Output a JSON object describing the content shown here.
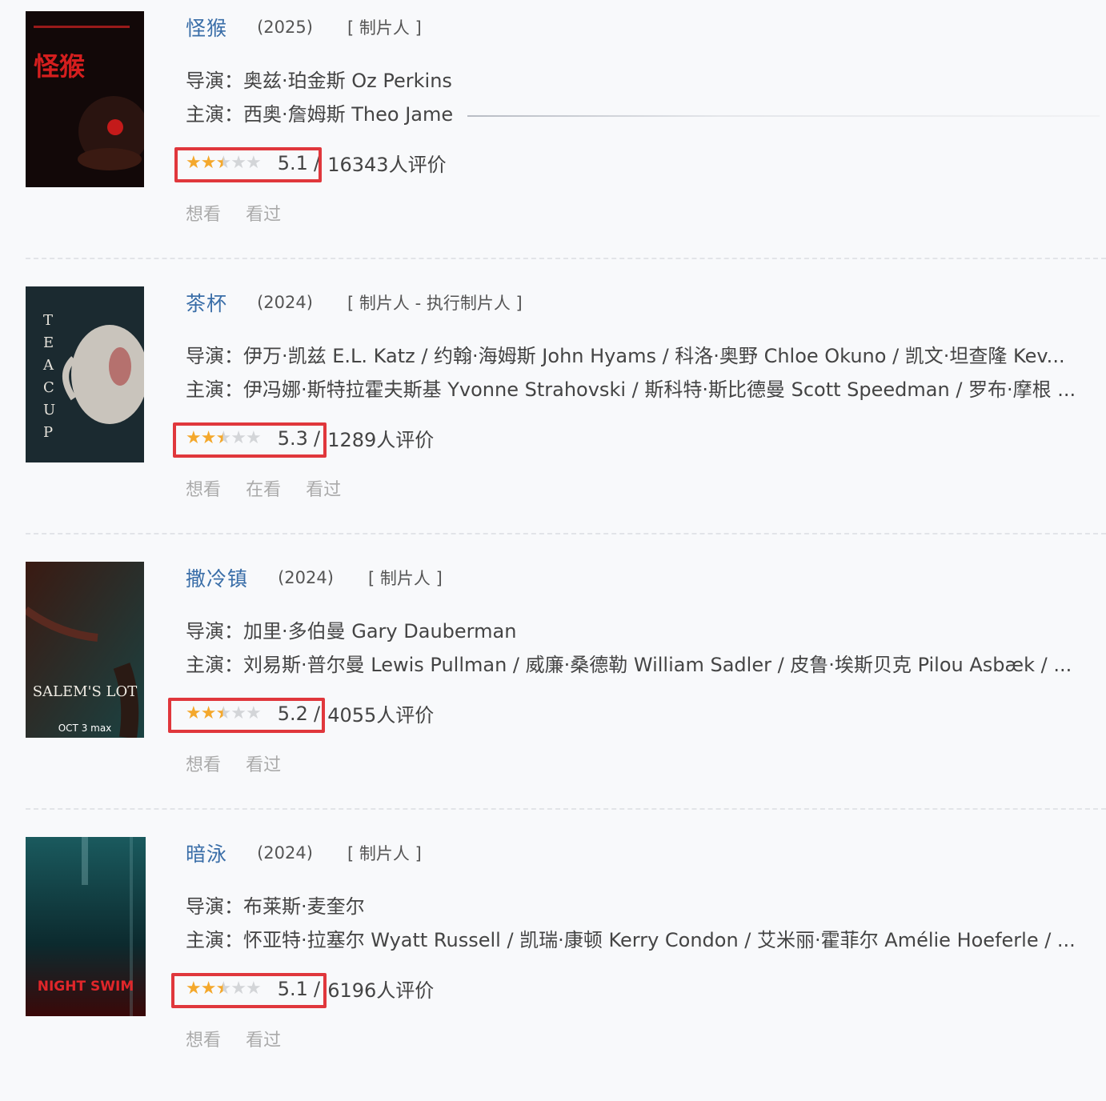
{
  "labels": {
    "director": "导演：",
    "cast": "主演：",
    "rating_suffix": "人评价"
  },
  "items": [
    {
      "title": "怪猴",
      "year": "(2025)",
      "role": "[ 制片人 ]",
      "directors": "奥兹·珀金斯 Oz Perkins",
      "cast": "西奥·詹姆斯 Theo Jame",
      "score": "5.1",
      "separator": "/",
      "count": "16343人评价",
      "stars": 2.5,
      "actions": [
        "想看",
        "看过"
      ],
      "poster_colors": [
        "#1a0a0a",
        "#c41a1a"
      ],
      "poster_text": "怪猴"
    },
    {
      "title": "茶杯",
      "year": "(2024)",
      "role": "[ 制片人 - 执行制片人 ]",
      "directors": "伊万·凯兹 E.L. Katz / 约翰·海姆斯 John Hyams / 科洛·奥野 Chloe Okuno / 凯文·坦查隆 Kev...",
      "cast": "伊冯娜·斯特拉霍夫斯基 Yvonne Strahovski / 斯科特·斯比德曼 Scott Speedman / 罗布·摩根 ...",
      "score": "5.3",
      "separator": "/",
      "count": "1289人评价",
      "stars": 2.5,
      "actions": [
        "想看",
        "在看",
        "看过"
      ],
      "poster_colors": [
        "#1b2a30",
        "#5c7a82"
      ],
      "poster_text": "TEACUP"
    },
    {
      "title": "撒冷镇",
      "year": "(2024)",
      "role": "[ 制片人 ]",
      "directors": "加里·多伯曼 Gary Dauberman",
      "cast": "刘易斯·普尔曼 Lewis Pullman / 威廉·桑德勒 William Sadler / 皮鲁·埃斯贝克 Pilou Asbæk / ...",
      "score": "5.2",
      "separator": "/",
      "count": "4055人评价",
      "stars": 2.5,
      "actions": [
        "想看",
        "看过"
      ],
      "poster_colors": [
        "#2a1410",
        "#1f4a4a"
      ],
      "poster_text": "SALEM'S LOT"
    },
    {
      "title": "暗泳",
      "year": "(2024)",
      "role": "[ 制片人 ]",
      "directors": "布莱斯·麦奎尔",
      "cast": "怀亚特·拉塞尔 Wyatt Russell / 凯瑞·康顿 Kerry Condon / 艾米丽·霍菲尔 Amélie Hoeferle / ...",
      "score": "5.1",
      "separator": "/",
      "count": "6196人评价",
      "stars": 2.5,
      "actions": [
        "想看",
        "看过"
      ],
      "poster_colors": [
        "#0e3a3e",
        "#5a1010"
      ],
      "poster_text": "NIGHT SWIM"
    }
  ]
}
